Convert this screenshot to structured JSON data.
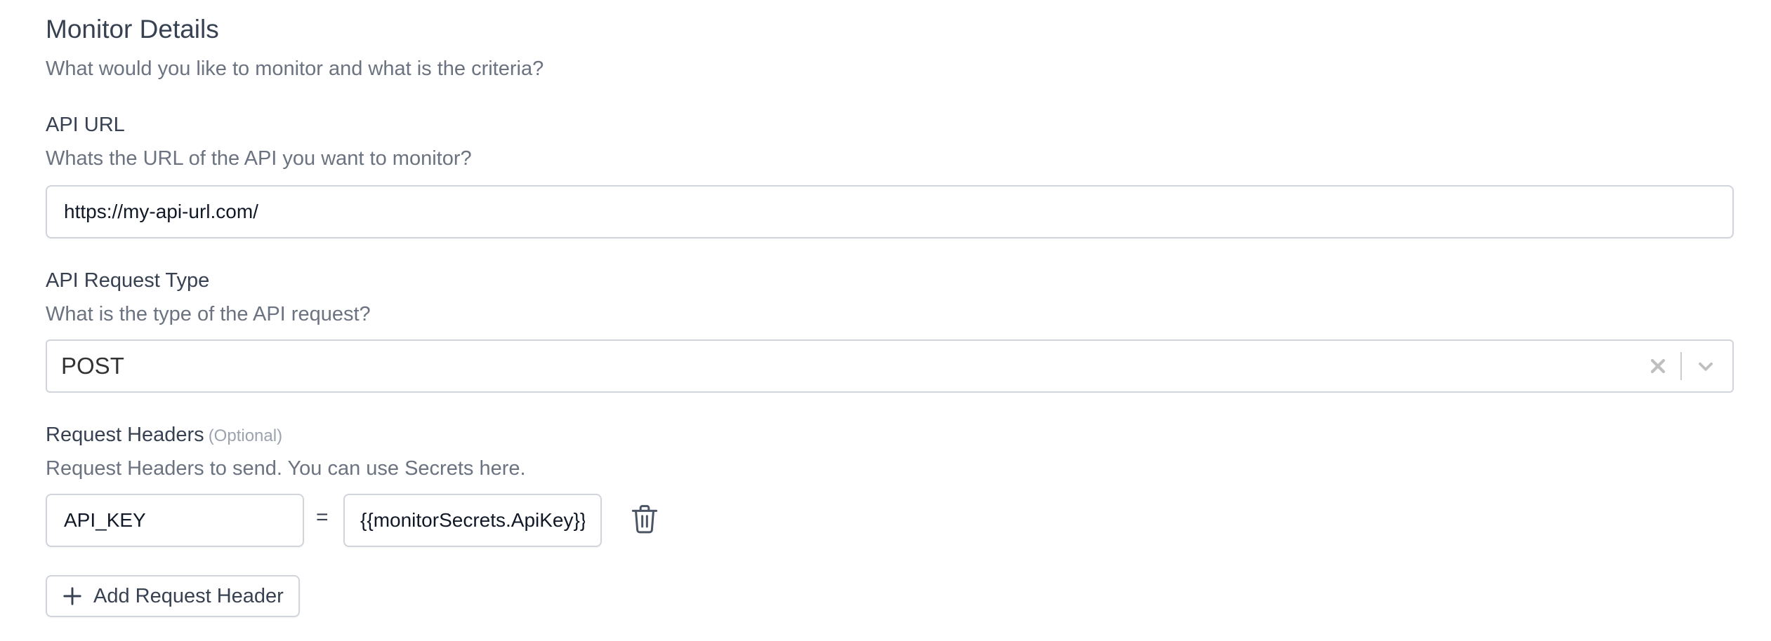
{
  "section": {
    "title": "Monitor Details",
    "description": "What would you like to monitor and what is the criteria?"
  },
  "api_url": {
    "label": "API URL",
    "description": "Whats the URL of the API you want to monitor?",
    "value": "https://my-api-url.com/"
  },
  "request_type": {
    "label": "API Request Type",
    "description": "What is the type of the API request?",
    "selected": "POST",
    "clear_icon": "close-icon",
    "dropdown_icon": "chevron-down-icon"
  },
  "headers": {
    "label": "Request Headers",
    "optional_tag": "(Optional)",
    "description": "Request Headers to send. You can use Secrets here.",
    "rows": [
      {
        "key": "API_KEY",
        "separator": "=",
        "value": "{{monitorSecrets.ApiKey}}"
      }
    ],
    "delete_icon": "trash-icon",
    "add_button_label": "Add Request Header",
    "add_icon": "plus-icon"
  },
  "colors": {
    "text": "#374151",
    "muted": "#6b7280",
    "border": "#d1d5db"
  }
}
